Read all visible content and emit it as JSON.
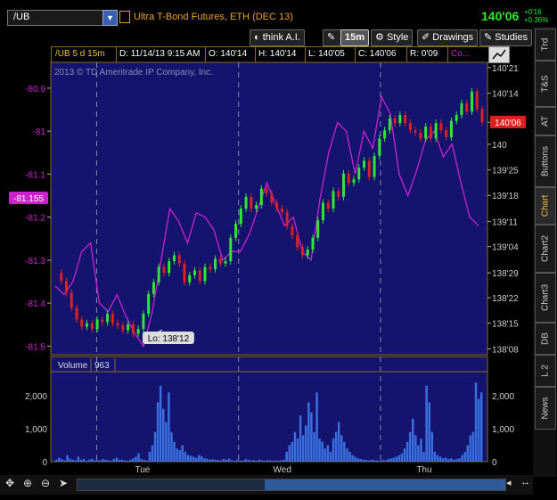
{
  "top": {
    "symbol": "/UB",
    "instrument": "Ultra T-Bond Futures, ETH (DEC 13)",
    "last": "140'06",
    "change1": "+0'16",
    "change2": "+0.36%"
  },
  "toolbar": {
    "think": "think A.I.",
    "interval": "15m",
    "style": "Style",
    "drawings": "Drawings",
    "studies": "Studies"
  },
  "info": {
    "symbol": "/UB 5 d 15m",
    "date": "D: 11/14/13 9:15 AM",
    "open": "O: 140'14",
    "high": "H: 140'14",
    "low": "L: 140'05",
    "close": "C: 140'06",
    "range": "R: 0'09",
    "extra": "Co..."
  },
  "side_tabs": [
    "Trd",
    "T&S",
    "AT",
    "Buttons",
    "Chart",
    "Chart2",
    "Chart3",
    "DB",
    "L 2",
    "News"
  ],
  "colors": {
    "up": "#2ee82e",
    "down": "#e02020",
    "comparison": "#cc22cc",
    "bg": "#14146e",
    "grid": "#3a3a88",
    "axis": "#aaaaaa"
  },
  "chart_data": {
    "type": "line",
    "watermark": "2013 © TD Ameritrade IP Company, Inc.",
    "x_ticks": [
      "Tue",
      "Wed",
      "Thu"
    ],
    "price_ticks": [
      "140'21",
      "140'14",
      "140'06",
      "140",
      "139'25",
      "139'18",
      "139'11",
      "139'04",
      "138'29",
      "138'22",
      "138'15",
      "138'08"
    ],
    "left_ticks": [
      "-80.9",
      "-81",
      "-81.1",
      "-81.2",
      "-81.3",
      "-81.4",
      "-81.5"
    ],
    "left_marker": "-81.155",
    "last_price_label": "140'06",
    "low_label": "Lo: 138'12",
    "ylim_price": [
      138.2,
      140.7
    ],
    "ylim_left": [
      -81.52,
      -80.84
    ],
    "series": [
      {
        "name": "/UB",
        "values": [
          138.9,
          138.83,
          138.73,
          138.6,
          138.5,
          138.44,
          138.47,
          138.42,
          138.5,
          138.48,
          138.55,
          138.47,
          138.45,
          138.41,
          138.46,
          138.38,
          138.42,
          138.55,
          138.72,
          138.82,
          138.95,
          138.9,
          139.0,
          139.05,
          138.98,
          138.82,
          138.88,
          138.92,
          138.83,
          138.95,
          138.93,
          139.02,
          138.98,
          139.0,
          139.2,
          139.32,
          139.45,
          139.55,
          139.45,
          139.48,
          139.62,
          139.58,
          139.5,
          139.45,
          139.42,
          139.3,
          139.22,
          139.12,
          139.05,
          139.1,
          139.2,
          139.35,
          139.5,
          139.45,
          139.6,
          139.55,
          139.75,
          139.67,
          139.7,
          139.8,
          139.86,
          139.72,
          139.9,
          140.05,
          140.12,
          140.22,
          140.18,
          140.25,
          140.18,
          140.12,
          140.1,
          140.05,
          140.15,
          140.05,
          140.18,
          140.12,
          140.06,
          140.2,
          140.25,
          140.35,
          140.28,
          140.45,
          140.3,
          140.19
        ]
      },
      {
        "name": "Comparison",
        "values": [
          -81.36,
          -81.38,
          -81.35,
          -81.28,
          -81.26,
          -81.4,
          -81.42,
          -81.38,
          -81.43,
          -81.47,
          -81.5,
          -81.42,
          -81.3,
          -81.18,
          -81.21,
          -81.26,
          -81.19,
          -81.2,
          -81.23,
          -81.3,
          -81.28,
          -81.28,
          -81.24,
          -81.18,
          -81.12,
          -81.17,
          -81.22,
          -81.2,
          -81.28,
          -81.3,
          -81.16,
          -81.05,
          -80.98,
          -81.0,
          -81.1,
          -81.0,
          -81.04,
          -80.92,
          -80.96,
          -81.1,
          -81.15,
          -81.09,
          -81.02,
          -81.0,
          -81.06,
          -81.03,
          -81.12,
          -81.2,
          -81.22
        ]
      }
    ],
    "volume": {
      "label": "Volume",
      "value": "963",
      "ticks": [
        "2,000",
        "1,000",
        "0"
      ],
      "ylim": [
        0,
        2700
      ],
      "values": [
        60,
        120,
        80,
        40,
        200,
        90,
        60,
        40,
        150,
        60,
        80,
        30,
        60,
        90,
        40,
        50,
        40,
        80,
        60,
        40,
        30,
        80,
        120,
        60,
        60,
        40,
        30,
        60,
        100,
        150,
        250,
        80,
        60,
        40,
        300,
        500,
        900,
        1800,
        2300,
        1600,
        1200,
        2100,
        900,
        600,
        400,
        350,
        500,
        300,
        200,
        180,
        150,
        120,
        200,
        160,
        100,
        90,
        60,
        80,
        60,
        50,
        40,
        80,
        60,
        90,
        40,
        30,
        60,
        40,
        30,
        80,
        60,
        40,
        50,
        30,
        60,
        40,
        30,
        50,
        40,
        30,
        40,
        30,
        40,
        60,
        300,
        500,
        600,
        900,
        700,
        1400,
        800,
        1100,
        1800,
        1500,
        900,
        2100,
        700,
        600,
        400,
        500,
        300,
        700,
        900,
        1200,
        800,
        600,
        400,
        300,
        200,
        150,
        100,
        80,
        60,
        50,
        40,
        60,
        50,
        40,
        30,
        60,
        40,
        80,
        100,
        120,
        150,
        200,
        250,
        400,
        600,
        900,
        1300,
        800,
        500,
        700,
        300,
        2300,
        1800,
        900,
        300,
        200,
        150,
        100,
        120,
        80,
        100,
        60,
        80,
        100,
        200,
        300,
        500,
        800,
        900,
        2400,
        1900,
        2100
      ]
    }
  }
}
